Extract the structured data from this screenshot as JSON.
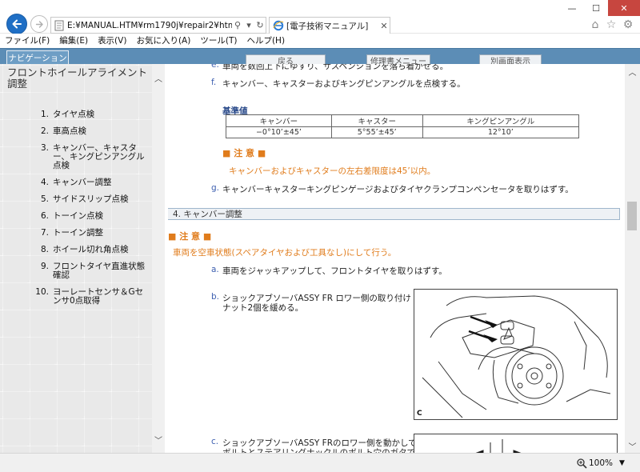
{
  "browser": {
    "address": "E:¥MANUAL.HTM¥rm1790j¥repair2¥html¥fram",
    "tab_title": "[電子技術マニュアル]",
    "zoom": "100%",
    "menu": [
      "ファイル(F)",
      "編集(E)",
      "表示(V)",
      "お気に入り(A)",
      "ツール(T)",
      "ヘルプ(H)"
    ]
  },
  "navstrip": {
    "nav_tab": "ナビゲーション",
    "back_button": "戻る",
    "manual_menu_button": "修理書メニュー",
    "separate_window_button": "別画面表示"
  },
  "left": {
    "title": "フロントホイールアライメント　調整",
    "toc": [
      {
        "num": "1.",
        "label": "タイヤ点検"
      },
      {
        "num": "2.",
        "label": "車高点検"
      },
      {
        "num": "3.",
        "label": "キャンバー、キャスター、キングピンアングル点検"
      },
      {
        "num": "4.",
        "label": "キャンバー調整"
      },
      {
        "num": "5.",
        "label": "サイドスリップ点検"
      },
      {
        "num": "6.",
        "label": "トーイン点検"
      },
      {
        "num": "7.",
        "label": "トーイン調整"
      },
      {
        "num": "8.",
        "label": "ホイール切れ角点検"
      },
      {
        "num": "9.",
        "label": "フロントタイヤ直進状態確認"
      },
      {
        "num": "10.",
        "label": "ヨーレートセンサ＆Gセンサ0点取得"
      }
    ]
  },
  "main": {
    "step_e": {
      "letter": "e.",
      "text": "車両を数回上下にゆすり、サスペンションを落ち着かせる。"
    },
    "step_f": {
      "letter": "f.",
      "text": "キャンバー、キャスターおよびキングピンアングルを点検する。"
    },
    "spec_heading": "基準値",
    "spec_table": {
      "headers": [
        "キャンバー",
        "キャスター",
        "キングピンアングル"
      ],
      "values": [
        "−0°10’±45’",
        "5°55’±45’",
        "12°10’"
      ]
    },
    "caution1_head": "■ 注 意 ■",
    "caution1_text": "キャンバーおよびキャスターの左右差限度は45’以内。",
    "step_g": {
      "letter": "g.",
      "text": "キャンバーキャスターキングピンゲージおよびタイヤクランプコンペンセータを取りはずす。"
    },
    "section4_title": "4. キャンバー調整",
    "caution2_head": "■ 注 意 ■",
    "caution2_text": "車両を空車状態(スペアタイヤおよび工具なし)にして行う。",
    "step_a": {
      "letter": "a.",
      "text": "車両をジャッキアップして、フロントタイヤを取りはずす。"
    },
    "step_b": {
      "letter": "b.",
      "line1": "ショックアブソーバASSY FR ロワー側の取り付け",
      "line2": "ナット2個を緩める。"
    },
    "step_c": {
      "letter": "c.",
      "line1": "ショックアブソーバASSY FRのロワー側を動かして、",
      "line2": "ボルトとステアリングナックルのボルト穴のガタでキャ"
    },
    "figure_b_label": "C"
  }
}
